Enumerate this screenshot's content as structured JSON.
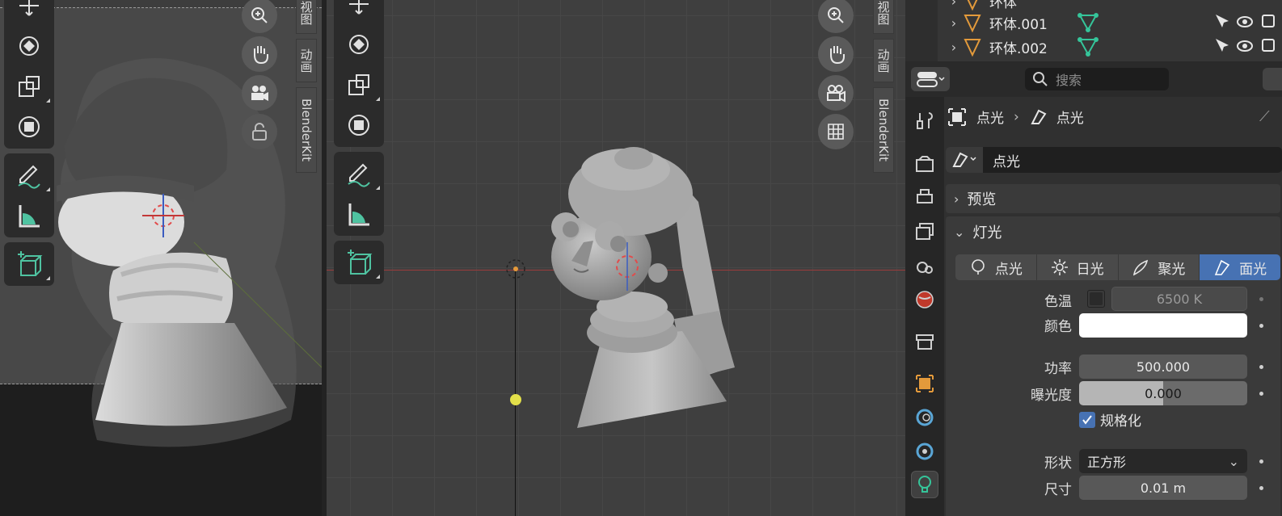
{
  "viewport_left": {
    "tabs": [
      "视图",
      "动画",
      "BlenderKit"
    ]
  },
  "viewport_mid": {
    "tabs": [
      "视图",
      "动画",
      "BlenderKit"
    ]
  },
  "outliner": {
    "rows": [
      {
        "name": "环体"
      },
      {
        "name": "环体.001"
      },
      {
        "name": "环体.002"
      }
    ]
  },
  "properties": {
    "search_placeholder": "搜索",
    "breadcrumb": [
      "点光",
      "点光"
    ],
    "datablock_name": "点光",
    "preview_label": "预览",
    "light_label": "灯光",
    "light_types": [
      {
        "label": "点光",
        "active": false
      },
      {
        "label": "日光",
        "active": false
      },
      {
        "label": "聚光",
        "active": false
      },
      {
        "label": "面光",
        "active": true
      }
    ],
    "color_temp_label": "色温",
    "color_temp_value": "6500 K",
    "color_label": "颜色",
    "power_label": "功率",
    "power_value": "500.000",
    "exposure_label": "曝光度",
    "exposure_value": "0.000",
    "normalize_label": "规格化",
    "shape_label": "形状",
    "shape_value": "正方形",
    "size_label": "尺寸",
    "size_value": "0.01 m"
  },
  "colors": {
    "accent": "#4772b3",
    "object_orange": "#e39a3b",
    "mesh_green": "#35c59a",
    "light_yellow": "#e3e04a"
  }
}
